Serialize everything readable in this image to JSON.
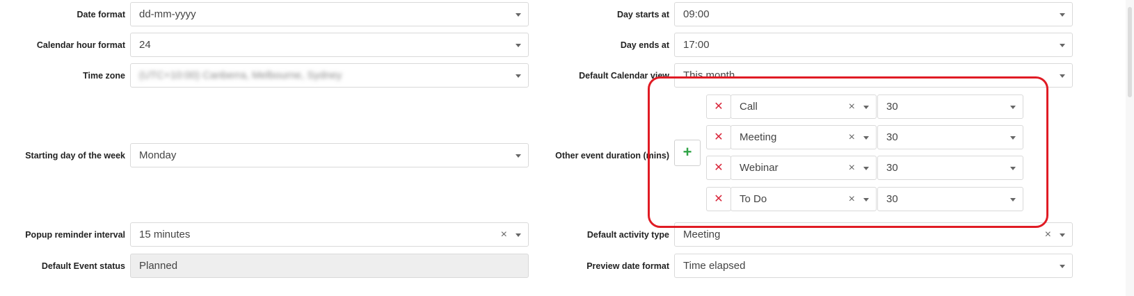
{
  "left": {
    "date_format": {
      "label": "Date format",
      "value": "dd-mm-yyyy"
    },
    "calendar_hour_format": {
      "label": "Calendar hour format",
      "value": "24"
    },
    "time_zone": {
      "label": "Time zone",
      "value": "(UTC+10:00) Canberra, Melbourne, Sydney"
    },
    "starting_day": {
      "label": "Starting day of the week",
      "value": "Monday"
    },
    "popup_reminder": {
      "label": "Popup reminder interval",
      "value": "15 minutes",
      "clear": "×"
    },
    "event_status": {
      "label": "Default Event status",
      "value": "Planned"
    }
  },
  "right": {
    "day_starts": {
      "label": "Day starts at",
      "value": "09:00"
    },
    "day_ends": {
      "label": "Day ends at",
      "value": "17:00"
    },
    "calendar_view": {
      "label": "Default Calendar view",
      "value": "This month"
    },
    "other_duration": {
      "label": "Other event duration (mins)",
      "add_label": "+",
      "remove_label": "✕",
      "clear_label": "×",
      "rows": [
        {
          "type": "Call",
          "duration": "30"
        },
        {
          "type": "Meeting",
          "duration": "30"
        },
        {
          "type": "Webinar",
          "duration": "30"
        },
        {
          "type": "To Do",
          "duration": "30"
        }
      ]
    },
    "activity_type": {
      "label": "Default activity type",
      "value": "Meeting",
      "clear": "×"
    },
    "preview_date": {
      "label": "Preview date format",
      "value": "Time elapsed"
    }
  }
}
